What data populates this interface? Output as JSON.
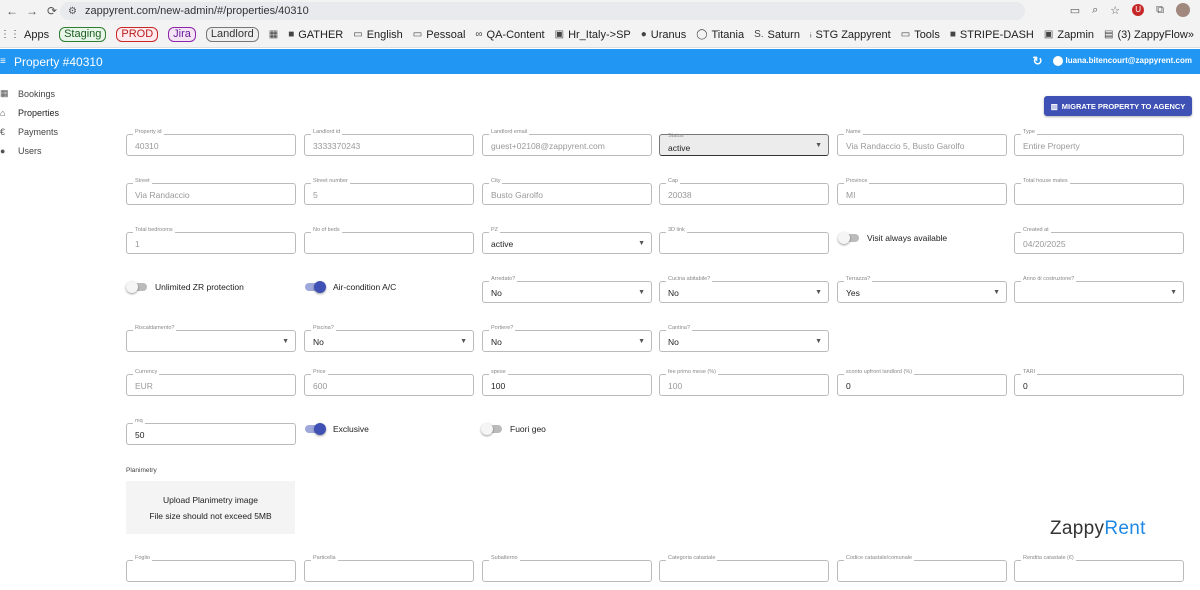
{
  "browser": {
    "url": "zappyrent.com/new-admin/#/properties/40310",
    "bookmarks": {
      "apps": "Apps",
      "staging": "Staging",
      "prod": "PROD",
      "jira": "Jira",
      "landlord": "Landlord",
      "items": [
        "GATHER",
        "English",
        "Pessoal",
        "QA-Content",
        "Hr_Italy->SP",
        "Uranus",
        "Titania",
        "Saturn",
        "STG Zappyrent",
        "Tools",
        "STRIPE-DASH",
        "Zapmin",
        "(3) ZappyFlow"
      ]
    }
  },
  "appbar": {
    "title": "Property #40310",
    "user_email": "luana.bitencourt@zappyrent.com"
  },
  "sidebar": {
    "items": [
      {
        "label": "Bookings",
        "icon": "calendar-icon"
      },
      {
        "label": "Properties",
        "icon": "home-icon"
      },
      {
        "label": "Payments",
        "icon": "euro-icon"
      },
      {
        "label": "Users",
        "icon": "person-icon"
      }
    ]
  },
  "actions": {
    "migrate": "MIGRATE PROPERTY TO AGENCY"
  },
  "fields": {
    "property_id": {
      "label": "Property id",
      "value": "40310"
    },
    "landlord_id": {
      "label": "Landlord id",
      "value": "3333370243"
    },
    "landlord_email": {
      "label": "Landlord email",
      "value": "guest+02108@zappyrent.com"
    },
    "status": {
      "label": "Status",
      "value": "active"
    },
    "name": {
      "label": "Name",
      "value": "Via Randaccio 5, Busto Garolfo"
    },
    "type": {
      "label": "Type",
      "value": "Entire Property"
    },
    "street": {
      "label": "Street",
      "value": "Via Randaccio"
    },
    "street_number": {
      "label": "Street number",
      "value": "5"
    },
    "city": {
      "label": "City",
      "value": "Busto Garolfo"
    },
    "cap": {
      "label": "Cap",
      "value": "20038"
    },
    "province": {
      "label": "Province",
      "value": "MI"
    },
    "total_house_mates": {
      "label": "Total house mates",
      "value": ""
    },
    "total_bedrooms": {
      "label": "Total bedrooms",
      "value": "1"
    },
    "no_of_beds": {
      "label": "No of beds",
      "value": ""
    },
    "pz": {
      "label": "PZ",
      "value": "active"
    },
    "link_3d": {
      "label": "3D link",
      "value": ""
    },
    "visit_always_available": {
      "label": "Visit always available",
      "on": false
    },
    "created_at": {
      "label": "Created at",
      "value": "04/20/2025"
    },
    "unlimited_zr": {
      "label": "Unlimited ZR protection",
      "on": false
    },
    "air_condition": {
      "label": "Air-condition A/C",
      "on": true
    },
    "arredato": {
      "label": "Arredato?",
      "value": "No"
    },
    "cucina_abitabile": {
      "label": "Cucina abitabile?",
      "value": "No"
    },
    "terrazza": {
      "label": "Terrazza?",
      "value": "Yes"
    },
    "anno_costruzione": {
      "label": "Anno di costruzione?",
      "value": ""
    },
    "riscaldamento": {
      "label": "Riscaldamento?",
      "value": ""
    },
    "piscina": {
      "label": "Piscina?",
      "value": "No"
    },
    "portiere": {
      "label": "Portiere?",
      "value": "No"
    },
    "cantina": {
      "label": "Cantina?",
      "value": "No"
    },
    "currency": {
      "label": "Currency",
      "value": "EUR"
    },
    "price": {
      "label": "Price",
      "value": "600"
    },
    "spese": {
      "label": "spese",
      "value": "100"
    },
    "fee_primo_mese": {
      "label": "fee primo mese (%)",
      "value": "100"
    },
    "sconto_upfront": {
      "label": "sconto upfront landlord (%)",
      "value": "0"
    },
    "tari": {
      "label": "TARI",
      "value": "0"
    },
    "mq": {
      "label": "mq",
      "value": "50"
    },
    "exclusive": {
      "label": "Exclusive",
      "on": true
    },
    "fuori_geo": {
      "label": "Fuori geo",
      "on": false
    },
    "foglio": {
      "label": "Foglio",
      "value": ""
    },
    "particella": {
      "label": "Particella",
      "value": ""
    },
    "subalterno": {
      "label": "Subalterno",
      "value": ""
    },
    "categoria_catastale": {
      "label": "Categoria catastale",
      "value": ""
    },
    "codice_catastale": {
      "label": "Codice catastale/comunale",
      "value": ""
    },
    "rendita_catastale": {
      "label": "Rendita catastale (€)",
      "value": ""
    }
  },
  "planimetry": {
    "label": "Planimetry",
    "upload_title": "Upload Planimetry image",
    "upload_hint": "File size should not exceed 5MB"
  },
  "logo": {
    "part1": "Zappy",
    "part2": "Rent"
  },
  "colors": {
    "appbar": "#2196f3",
    "accent": "#3f51b5"
  }
}
